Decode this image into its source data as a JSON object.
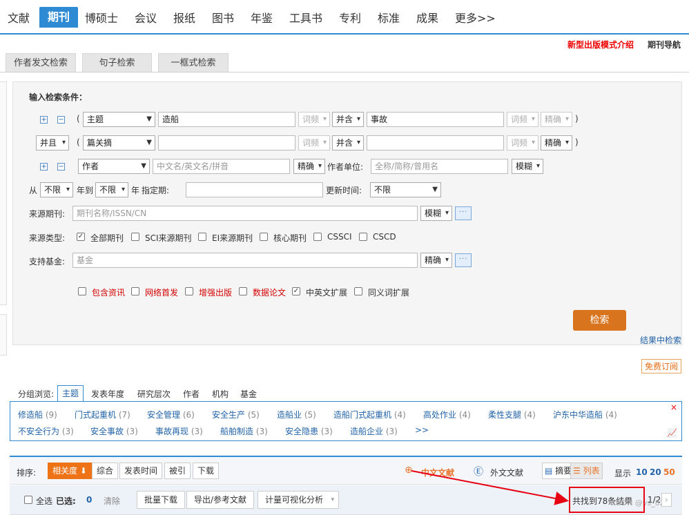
{
  "nav": {
    "items": [
      "文献",
      "期刊",
      "博硕士",
      "会议",
      "报纸",
      "图书",
      "年鉴",
      "工具书",
      "专利",
      "标准",
      "成果",
      "更多>>"
    ],
    "active": "期刊"
  },
  "header_links": {
    "promo": "新型出版模式介绍",
    "journal_nav": "期刊导航"
  },
  "tabs": [
    "作者发文检索",
    "句子检索",
    "一框式检索"
  ],
  "search": {
    "title": "输入检索条件：",
    "row1": {
      "field": "主题",
      "value": "造船",
      "freq1": "词频",
      "op": "并含",
      "value2": "事故",
      "freq2": "词频",
      "match": "精确"
    },
    "row2": {
      "logic": "并且",
      "field": "篇关摘",
      "value": "",
      "freq1": "词频",
      "op": "并含",
      "value2": "",
      "freq2": "词频",
      "match": "精确"
    },
    "row3": {
      "field": "作者",
      "placeholder": "中文名/英文名/拼音",
      "match": "精确",
      "unit_label": "作者单位:",
      "unit_placeholder": "全称/简称/曾用名",
      "unit_match": "模糊"
    },
    "date": {
      "from_label": "从",
      "from": "不限",
      "year_to": "年到",
      "to": "不限",
      "year": "年",
      "spec_label": "指定期:",
      "update_label": "更新时间:",
      "update": "不限"
    },
    "source": {
      "label": "来源期刊:",
      "placeholder": "期刊名称/ISSN/CN",
      "match": "模糊",
      "more": "···"
    },
    "source_type": {
      "label": "来源类型:",
      "options": [
        "全部期刊",
        "SCI来源期刊",
        "EI来源期刊",
        "核心期刊",
        "CSSCI",
        "CSCD"
      ]
    },
    "fund": {
      "label": "支持基金:",
      "placeholder": "基金",
      "match": "精确",
      "more": "···"
    },
    "extras": [
      "包含资讯",
      "网络首发",
      "增强出版",
      "数据论文",
      "中英文扩展",
      "同义词扩展"
    ],
    "search_button": "检索",
    "in_results": "结果中检索"
  },
  "free_subscribe": "免费订阅",
  "group": {
    "label": "分组浏览:",
    "tabs": [
      "主题",
      "发表年度",
      "研究层次",
      "作者",
      "机构",
      "基金"
    ],
    "keywords_row1": [
      {
        "k": "修造船",
        "n": "(9)"
      },
      {
        "k": "门式起重机",
        "n": "(7)"
      },
      {
        "k": "安全管理",
        "n": "(6)"
      },
      {
        "k": "安全生产",
        "n": "(5)"
      },
      {
        "k": "造船业",
        "n": "(5)"
      },
      {
        "k": "造船门式起重机",
        "n": "(4)"
      },
      {
        "k": "高处作业",
        "n": "(4)"
      },
      {
        "k": "柔性支腿",
        "n": "(4)"
      },
      {
        "k": "沪东中华造船",
        "n": "(4)"
      }
    ],
    "keywords_row2": [
      {
        "k": "不安全行为",
        "n": "(3)"
      },
      {
        "k": "安全事故",
        "n": "(3)"
      },
      {
        "k": "事故再现",
        "n": "(3)"
      },
      {
        "k": "船舶制造",
        "n": "(3)"
      },
      {
        "k": "安全隐患",
        "n": "(3)"
      },
      {
        "k": "造船企业",
        "n": "(3)"
      },
      {
        "k": ">>",
        "n": ""
      }
    ]
  },
  "sort": {
    "label": "排序:",
    "options": [
      "相关度",
      "综合",
      "发表时间",
      "被引",
      "下载"
    ],
    "zh": "中文文献",
    "en": "外文文献",
    "view_abstract": "摘要",
    "view_list": "列表",
    "show_label": "显示",
    "sizes": [
      "10",
      "20",
      "50"
    ]
  },
  "actions": {
    "select_all": "全选",
    "selected_label": "已选:",
    "selected_count": "0",
    "clear": "清除",
    "buttons": [
      "批量下载",
      "导出/参考文献",
      "计量可视化分析"
    ],
    "result_count": "共找到78条结果",
    "page": "1/2",
    "watermark": "CSDN @ys_828"
  },
  "colors": {
    "primary": "#2d8ad3",
    "accent": "#ee7317",
    "highlight": "#e60012"
  }
}
